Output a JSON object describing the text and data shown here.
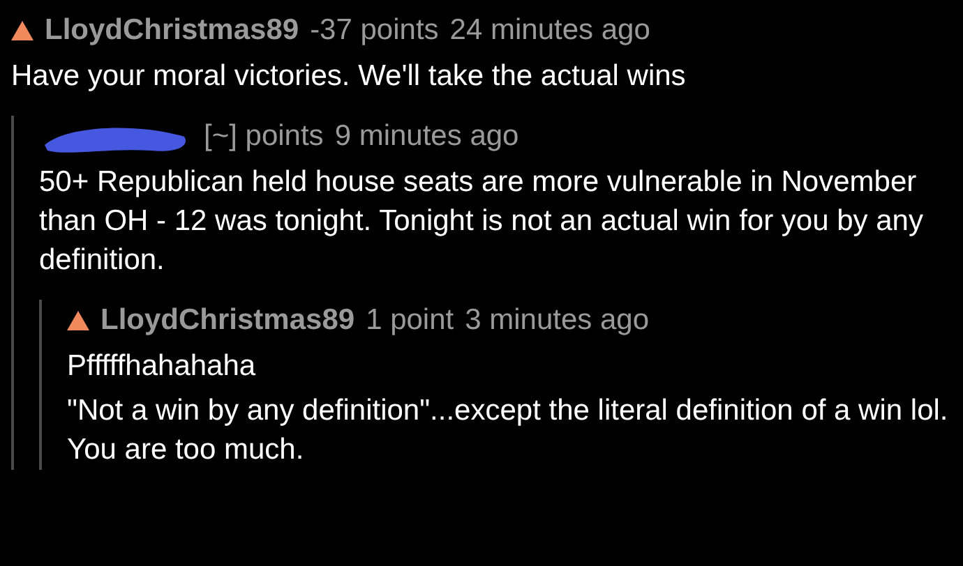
{
  "comment": {
    "upvoted": true,
    "author": "LloydChristmas89",
    "score": "-37 points",
    "time": "24 minutes ago",
    "paragraphs": [
      "Have your moral victories. We'll take the actual wins"
    ],
    "reply": {
      "author_redacted": true,
      "score": "[~] points",
      "time": "9 minutes ago",
      "paragraphs": [
        "50+ Republican held house seats are more vulnerable in November than OH - 12 was tonight. Tonight is not an actual win for you by any definition."
      ],
      "reply": {
        "upvoted": true,
        "author": "LloydChristmas89",
        "score": "1 point",
        "time": "3 minutes ago",
        "paragraphs": [
          "Pfffffhahahaha",
          "\"Not a win by any definition\"...except the literal definition of a win lol. You are too much."
        ]
      }
    }
  }
}
